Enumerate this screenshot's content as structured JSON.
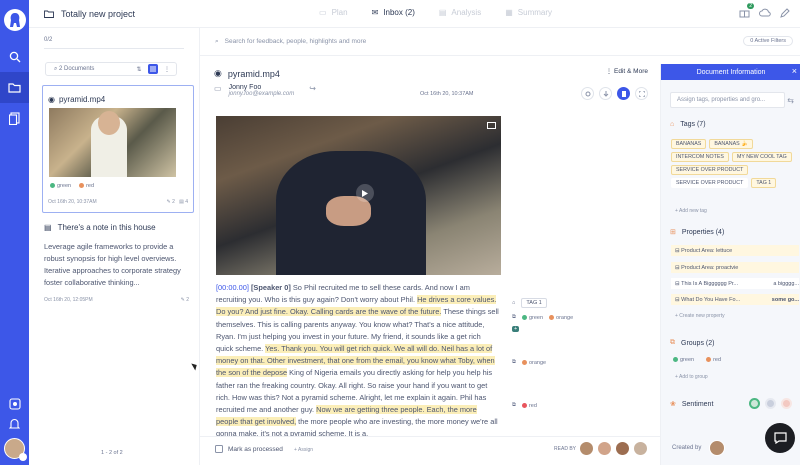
{
  "colors": {
    "accent": "#3d57e8",
    "highlight": "#fbeeb8",
    "green": "#4cb782",
    "red": "#e8915d"
  },
  "header": {
    "project": "Totally new project",
    "tabs": [
      {
        "label": "Plan",
        "icon": "plan-icon"
      },
      {
        "label": "Inbox (2)",
        "icon": "inbox-icon",
        "active": true
      },
      {
        "label": "Analysis",
        "icon": "analysis-icon"
      },
      {
        "label": "Summary",
        "icon": "summary-icon"
      }
    ],
    "gift_count": "2"
  },
  "left": {
    "count": "0/2",
    "documents_label": "2 Documents",
    "video_card": {
      "title": "pyramid.mp4",
      "tags": [
        "green",
        "red"
      ],
      "date": "Oct 16th 20, 10:37AM",
      "highlights": "2",
      "notes": "4"
    },
    "note_card": {
      "title": "There's a note in this house",
      "body": "Leverage agile frameworks to provide a robust synopsis for high level overviews. Iterative approaches to corporate strategy foster collaborative thinking...",
      "date": "Oct 16th 20, 12:05PM",
      "count": "2"
    },
    "pager": "1 - 2 of 2"
  },
  "search": {
    "placeholder": "Search for feedback, people, highlights and more",
    "active_filters": "0 Active Filters"
  },
  "document": {
    "filename": "pyramid.mp4",
    "edit": "Edit & More",
    "author_name": "Jonny Foo",
    "author_email": "jonny.foo@example.com",
    "date": "Oct 16th 20, 10:37AM",
    "transcript": {
      "timestamp": "[00:00.00]",
      "speaker": "[Speaker 0]",
      "t1": " So Phil recruited me to sell these cards. And now I am recruiting you. Who is this guy again? Don't worry about Phil. ",
      "h1": "He drives a core values. Do you? And just fine. Okay. Calling cards are the wave of the future.",
      "t2": " These things sell themselves. This is calling parents anyway. You know what? That's a nice attitude, Ryan. I'm just helping you invest in your future. My friend, it sounds like a get rich quick scheme. ",
      "h2": "Yes. Thank you. You will get rich quick. We all will do. Neil has a lot of money on that. Other investment, that one from the email, you know what Toby, when the son of the depose",
      "t3": " King of Nigeria emails you directly asking for help you help his father ran the freaking country. Okay. All right. So raise your hand if you want to get rich. How was this? Not a pyramid scheme. Alright, let me explain it again. Phil has recruited me and another guy. ",
      "h3": "Now we are getting three people. Each, the more people that get involved,",
      "t4": " the more people who are investing, the more money we're all gonna make. it's not a pyramid scheme. It is a,"
    },
    "side_tags": {
      "tag1": "TAG 1",
      "row1_green": "green",
      "row1_orange": "orange",
      "row2_orange": "orange",
      "row3_red": "red"
    },
    "mark_processed": "Mark as processed",
    "assign": "+ Assign",
    "read_by": "READ BY"
  },
  "info": {
    "title": "Document Information",
    "search_placeholder": "Assign tags, properties and gro...",
    "tags_title": "Tags (7)",
    "tags": [
      "BANANAS",
      "BANANAS 🍌",
      "INTERCOM NOTES",
      "MY NEW COOL TAG",
      "SERVICE OVER PRODUCT",
      "SERVICE OVER PRODUCT",
      "TAG 1"
    ],
    "add_tag": "+ Add new tag",
    "properties_title": "Properties (4)",
    "properties": [
      {
        "label": "Product Area: lettuce",
        "value": ""
      },
      {
        "label": "Product Area: proactvie",
        "value": ""
      },
      {
        "label": "This Is A Bigggggg Pr...",
        "value": "a bigggg..."
      },
      {
        "label": "What Do You Have Fo...",
        "value": "some go..."
      }
    ],
    "create_property": "+ Create new property",
    "groups_title": "Groups (2)",
    "groups": [
      "green",
      "red"
    ],
    "add_group": "+ Add to group",
    "sentiment_title": "Sentiment",
    "created_by": "Created by"
  }
}
